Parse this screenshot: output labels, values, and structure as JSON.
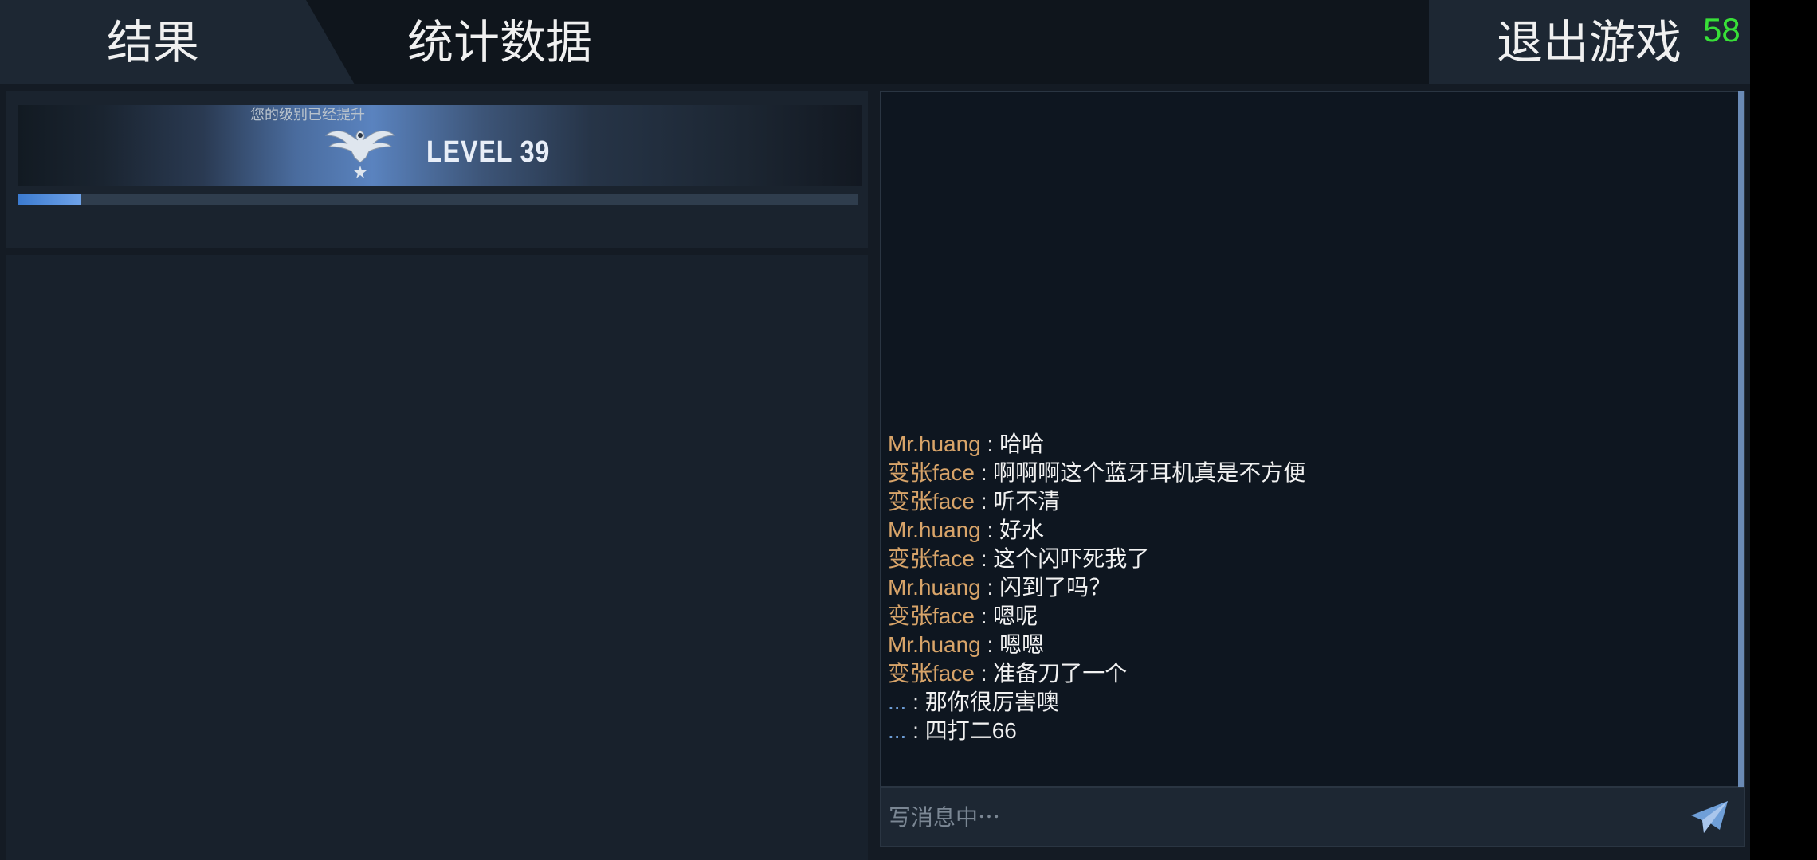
{
  "tabs": {
    "results": "结果",
    "stats": "统计数据"
  },
  "exit_label": "退出游戏",
  "fps": "58",
  "level": {
    "caption": "您的级别已经提升",
    "label": "LEVEL 39",
    "progress_fraction": 0.075
  },
  "chat": {
    "messages": [
      {
        "sender": "Mr.huang",
        "text": "哈哈"
      },
      {
        "sender": "变张face",
        "text": "啊啊啊这个蓝牙耳机真是不方便"
      },
      {
        "sender": "变张face",
        "text": "听不清"
      },
      {
        "sender": "Mr.huang",
        "text": "好水"
      },
      {
        "sender": "变张face",
        "text": "这个闪吓死我了"
      },
      {
        "sender": "Mr.huang",
        "text": "闪到了吗？"
      },
      {
        "sender": "变张face",
        "text": "嗯呢"
      },
      {
        "sender": "Mr.huang",
        "text": "嗯嗯"
      },
      {
        "sender": "变张face",
        "text": "准备刀了一个"
      },
      {
        "sender": "...",
        "text": "那你很厉害噢"
      },
      {
        "sender": "...",
        "text": "四打二66"
      }
    ],
    "separator": " : ",
    "input_placeholder": "写消息中⋯"
  },
  "colors": {
    "sender_orange": "#d8a469",
    "sender_blue": "#6f9fd8",
    "fps_green": "#38e038"
  },
  "icons": {
    "send": "paper-plane-icon",
    "rank": "eagle-icon"
  }
}
